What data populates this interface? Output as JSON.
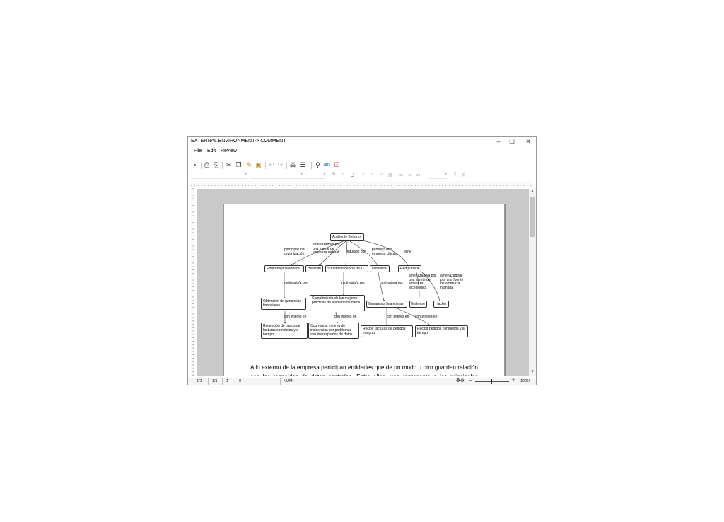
{
  "window": {
    "title": "EXTERNAL ENVIRONMENT-> COMMENT"
  },
  "menu": {
    "file": "File",
    "edit": "Edit",
    "review": "Review"
  },
  "concept_map": {
    "nodes": {
      "ambiente": "Ambiente Externo",
      "empresa": "Empresa proveedora",
      "huracan": "Huracán",
      "superintendencia": "Superintendencia de TI",
      "detallista": "Detallista",
      "red": "Red pública",
      "ganancias_obtencion": "Obtención de ganancias financieras",
      "cumplimiento": "Cumplimiento de las mejores prácticas de respaldo de datos",
      "ganancias": "Ganancias financieras",
      "malware": "Malware",
      "hacker": "Hacker",
      "recepcion": "Recepción de pagos de facturas completos y a tiempo",
      "ocurrencia": "Ocurrencia mínima de incidencias por problemas con los respaldos de datos",
      "recibir_facturas": "Recibir facturas de pedidos íntegras",
      "recibir_pedidos": "Recibir pedidos completos y a tiempo"
    },
    "links": {
      "participa_org": "participa una organización",
      "amenazado_natural": "amenazado/a por una fuente de amenaza natural",
      "regulado": "regulado por",
      "participa_cliente": "participa una empresa cliente",
      "tiene": "tiene",
      "motivado1": "motivado/a por",
      "motivado2": "motivado/a por",
      "motivado3": "motivado/a por",
      "amenazado_tec": "amenazado/a por una fuente de amenaza tecnológica",
      "amenazado_hum": "amenazado/a por una fuente de amenaza humana",
      "interes1": "con interés en",
      "interes2": "con interés en",
      "interes3": "con interés en",
      "interes4": "con interés en"
    }
  },
  "paragraph": "A lo externo de la empresa participan entidades que de un modo u otro guardan relación con los respaldos de datos centrales. Entre ellas, una representa a los principales clientes",
  "status": {
    "page1": "1/1",
    "page2": "1/1",
    "line": "1",
    "col": "0",
    "mode": "NUM",
    "zoom": "100%"
  }
}
